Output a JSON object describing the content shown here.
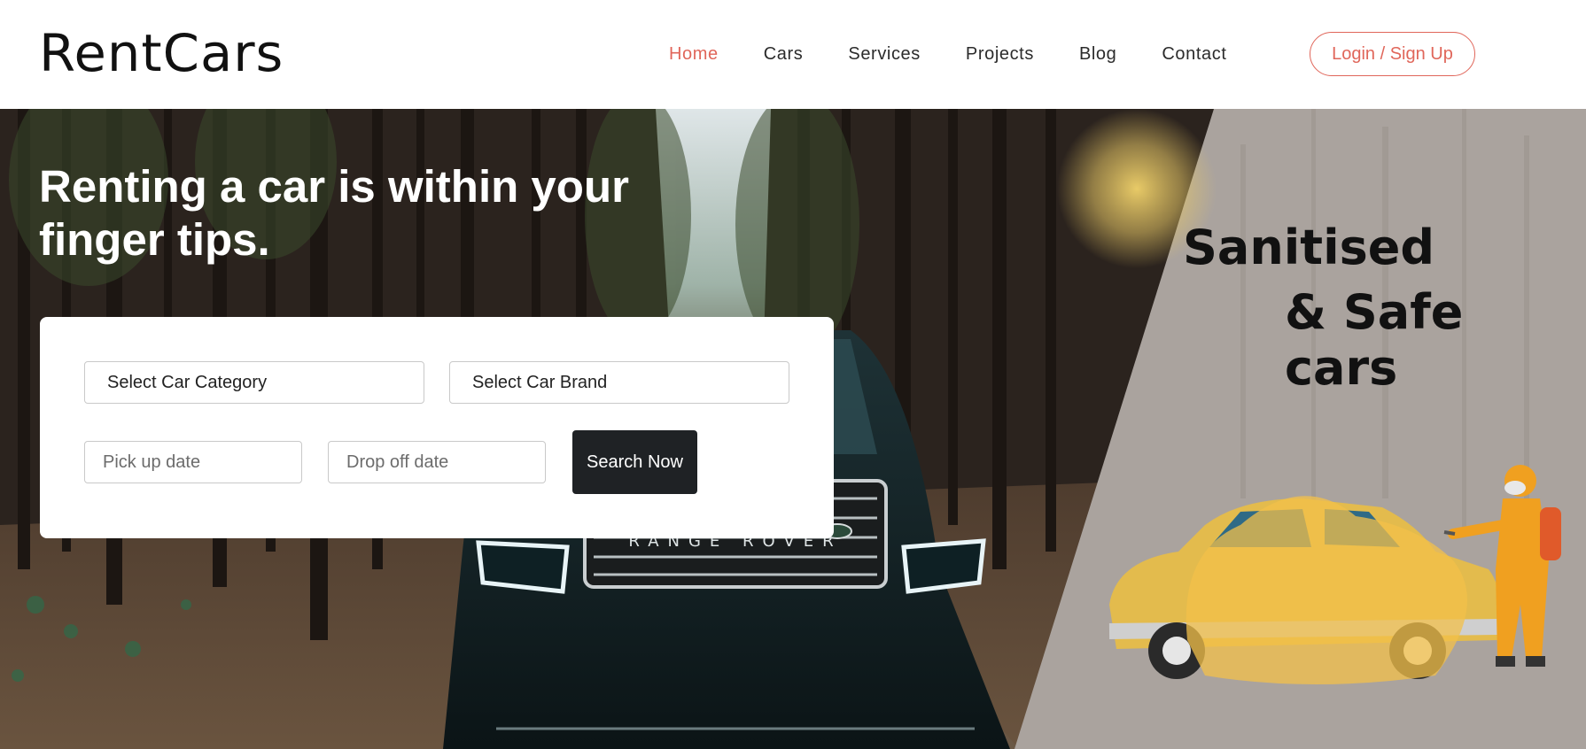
{
  "header": {
    "logo": "RentCars",
    "nav": [
      "Home",
      "Cars",
      "Services",
      "Projects",
      "Blog",
      "Contact"
    ],
    "active_nav": "Home",
    "login_label": "Login / Sign Up"
  },
  "hero": {
    "title_bold": "Renting a car",
    "title_rest": " is within your finger tips.",
    "search": {
      "category_value": "Select Car Category",
      "brand_value": "Select Car Brand",
      "pickup_placeholder": "Pick up date",
      "dropoff_placeholder": "Drop off date",
      "search_label": "Search Now"
    },
    "promo_line1": "Sanitised",
    "promo_line2": "& Safe cars",
    "car_grille_text": "RANGE ROVER"
  },
  "colors": {
    "accent": "#e0665a",
    "dark_button": "#1f2225",
    "promo_panel": "#aaa39e",
    "sanitise_yellow": "#f3c04a"
  }
}
